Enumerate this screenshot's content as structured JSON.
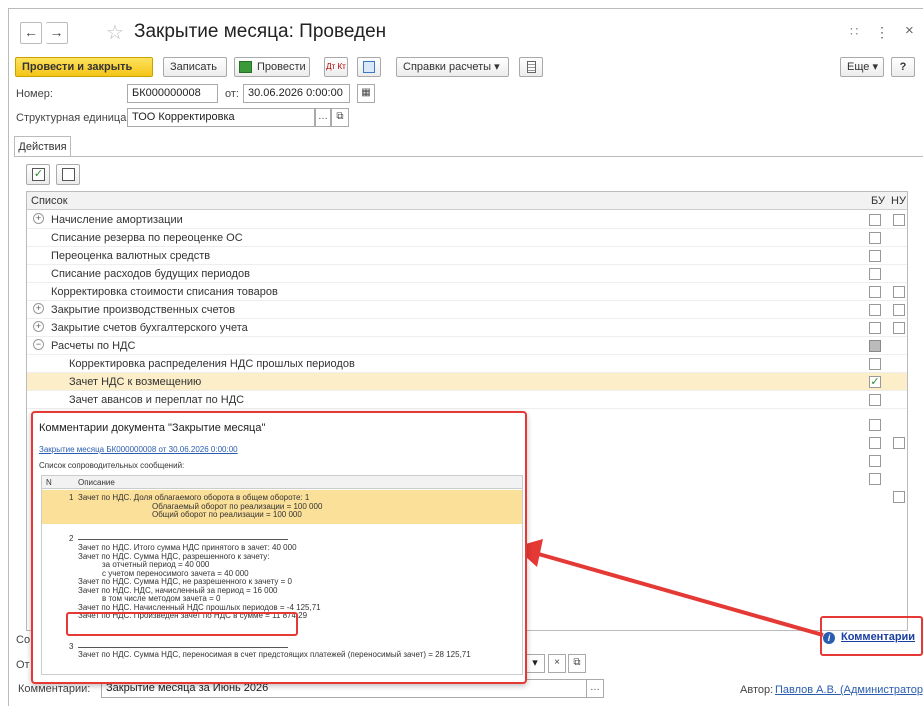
{
  "window": {
    "title": "Закрытие месяца: Проведен",
    "nav_back": "←",
    "nav_forward": "→",
    "star": "☆",
    "link_icon": "🔗",
    "more_icon": "⋮",
    "close_icon": "×"
  },
  "toolbar": {
    "post_close": "Провести и закрыть",
    "save": "Записать",
    "post": "Провести",
    "dt_kt": "Дт Кт",
    "reports": "Справки расчеты",
    "more": "Еще",
    "help": "?"
  },
  "form": {
    "number_label": "Номер:",
    "number_value": "БК000000008",
    "date_label": "от:",
    "date_value": "30.06.2026  0:00:00",
    "unit_label": "Структурная единица:",
    "unit_value": "ТОО Корректировка"
  },
  "tabs": {
    "actions": "Действия"
  },
  "table": {
    "col_list": "Список",
    "col_bu": "БУ",
    "col_nu": "НУ",
    "rows": [
      {
        "label": "Начисление амортизации",
        "expand": "+",
        "bu": "",
        "nu": ""
      },
      {
        "label": "Списание резерва по переоценке ОС",
        "expand": "",
        "bu": "",
        "nu": ""
      },
      {
        "label": "Переоценка валютных средств",
        "expand": "",
        "bu": "",
        "nu": ""
      },
      {
        "label": "Списание расходов будущих периодов",
        "expand": "",
        "bu": "",
        "nu": ""
      },
      {
        "label": "Корректировка стоимости списания товаров",
        "expand": "",
        "bu": "",
        "nu": ""
      },
      {
        "label": "Закрытие производственных счетов",
        "expand": "+",
        "bu": "",
        "nu": ""
      },
      {
        "label": "Закрытие счетов бухгалтерского учета",
        "expand": "+",
        "bu": "",
        "nu": ""
      },
      {
        "label": "Расчеты по НДС",
        "expand": "−",
        "bu": "",
        "nu": ""
      },
      {
        "label": "Корректировка распределения НДС прошлых периодов",
        "expand": "",
        "bu": "",
        "nu": ""
      },
      {
        "label": "Зачет НДС к возмещению",
        "expand": "",
        "bu": "✓",
        "nu": ""
      },
      {
        "label": "Зачет авансов и переплат по НДС",
        "expand": "",
        "bu": "",
        "nu": ""
      }
    ]
  },
  "popup": {
    "title": "Комментарии документа \"Закрытие месяца\"",
    "link": "Закрытие месяца БК000000008 от 30.06.2026 0:00:00",
    "subtitle": "Список сопроводительных сообщений:",
    "col_n": "N",
    "col_desc": "Описание",
    "msg1_n": "1",
    "msg1": [
      "Зачет по НДС. Доля облагаемого оборота в общем обороте: 1",
      "Облагаемый оборот по реализации = 100 000",
      "Общий оборот по реализации = 100 000"
    ],
    "msg2_n": "2",
    "msg2": [
      "Зачет по НДС. Итого сумма НДС принятого в зачет: 40 000",
      "Зачет по НДС. Сумма НДС, разрешенного к зачету:",
      "за отчетный период          = 40 000",
      "с учетом переносимого зачета      = 40 000",
      "Зачет по НДС. Сумма НДС, не разрешенного к зачету = 0",
      "Зачет по НДС. НДС, начисленный за период        = 16 000",
      "в том числе методом зачета        = 0",
      "Зачет по НДС. Начисленный НДС прошлых периодов    = -4 125,71",
      "Зачет по НДС. Произведен зачет по НДС в сумме     = 11 874,29"
    ],
    "msg3_n": "3",
    "msg3": [
      "Зачет по НДС. Сумма НДС, переносимая в счет предстоящих платежей (переносимый зачет) = 28 125,71"
    ]
  },
  "footer": {
    "left_partial1": "Со",
    "left_partial2": "От",
    "comment_label": "Комментарии:",
    "comment_value": "Закрытие месяца за Июнь 2026",
    "author_label": "Автор:",
    "author_value": "Павлов А.В. (Администратор)",
    "comments_link": "Комментарии",
    "info_icon": "i"
  }
}
